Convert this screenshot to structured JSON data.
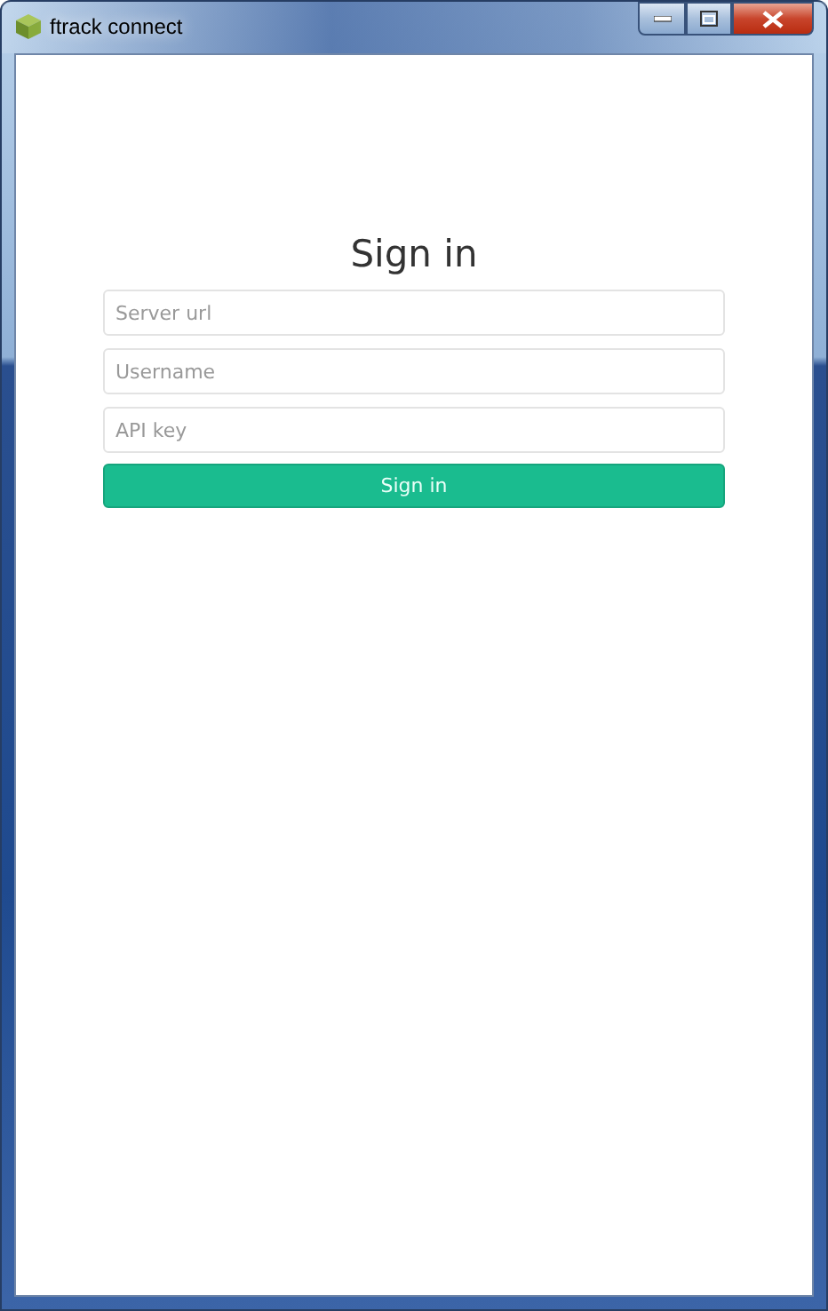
{
  "window": {
    "title": "ftrack connect"
  },
  "form": {
    "heading": "Sign in",
    "fields": [
      {
        "placeholder": "Server url"
      },
      {
        "placeholder": "Username"
      },
      {
        "placeholder": "API key"
      }
    ],
    "submit": "Sign in"
  }
}
